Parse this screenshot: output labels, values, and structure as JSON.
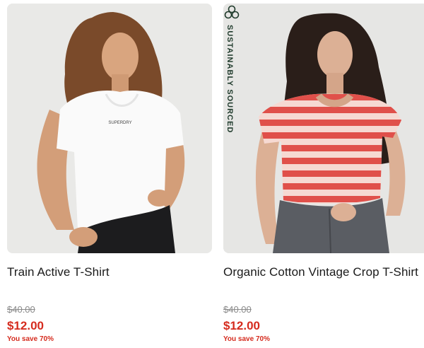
{
  "products": [
    {
      "title": "Train Active T-Shirt",
      "original_price": "$40.00",
      "sale_price": "$12.00",
      "savings": "You save 70%",
      "image": "woman-white-tshirt-photo"
    },
    {
      "title": "Organic Cotton Vintage Crop T-Shirt",
      "original_price": "$40.00",
      "sale_price": "$12.00",
      "savings": "You save 70%",
      "image": "woman-red-white-striped-tshirt-photo",
      "badge": "SUSTAINABLY SOURCED",
      "badge_icon": "leaf-cluster-icon"
    }
  ],
  "colors": {
    "sale_red": "#d52b1e",
    "badge_green": "#1f3a2b",
    "image_bg": "#e9e9e7"
  }
}
